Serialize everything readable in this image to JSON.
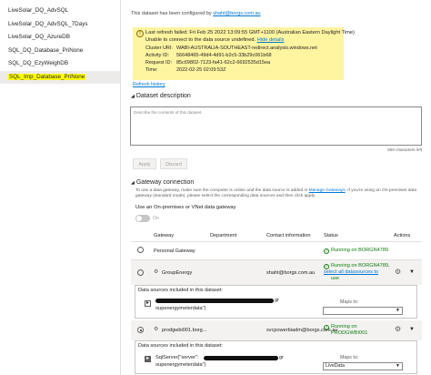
{
  "sidebar": {
    "items": [
      {
        "label": "LiveSolar_DQ_AdvSQL"
      },
      {
        "label": "LiveSolar_DQ_AdvSQL_7Days"
      },
      {
        "label": "LiveSolar_DQ_AzureDB"
      },
      {
        "label": "SQL_DQ_Database_PriNone"
      },
      {
        "label": "SQL_DQ_EzyWeighDB"
      },
      {
        "label": "SQL_Imp_Database_PriNone"
      }
    ],
    "selected_index": 5
  },
  "header": {
    "configured_prefix": "This dataset has been configured by",
    "configured_email": "shaht@borgs.com.au"
  },
  "alert": {
    "line1": "Last refresh failed: Fri Feb 25 2022 13:09:55 GMT+1100 (Australian Eastern Daylight Time)",
    "line2_text": "Unable to connect to the data source undefined.",
    "hide_details": "Hide details",
    "cluster_key": "Cluster URI:",
    "cluster_val": "WABI-AUSTRALIA-SOUTHEAST-redirect.analysis.windows.net",
    "activity_key": "Activity ID:",
    "activity_val": "56648465-49d4-4d91-b2c5-33b29c061b68",
    "request_key": "Request ID:",
    "request_val": "85c69802-7123-fa41-62c2-6692535d15ea",
    "time_key": "Time:",
    "time_val": "2022-02-25 02:09:53Z"
  },
  "refresh_history": "Refresh history",
  "dataset_description": {
    "title": "Dataset description",
    "placeholder": "Describe the contents of this dataset.",
    "char_count": "500 characters left",
    "apply": "Apply",
    "discard": "Discard"
  },
  "gateway": {
    "title": "Gateway connection",
    "help_prefix": "To use a data gateway, make sure the computer is online and the data source is added in",
    "help_link": "Manage Gateways",
    "help_suffix": ". If you're using an On-premises data",
    "help_line2": "gateway (standard mode), please select the corresponding data sources and then click apply.",
    "onprem_label": "Use an On-premises or VNet data gateway",
    "toggle_label": "On",
    "columns": {
      "gateway": "Gateway",
      "department": "Department",
      "contact": "Contact information",
      "status": "Status",
      "actions": "Actions"
    },
    "rows": [
      {
        "name": "Personal Gateway",
        "department": "",
        "contact": "",
        "status": "Running on BORGN4789"
      },
      {
        "name": "GroupEnergy",
        "department": "",
        "contact": "shaht@borgs.com.au",
        "status": "Running on BORGN4789,",
        "status_link": "select all datasources to",
        "status_tail": "use"
      },
      {
        "name": "prodgwbi001.borg...",
        "department": "",
        "contact": "svcpowerbiadm@borgs.com.au",
        "status": "Running on",
        "status2": "PRODGWBI001"
      }
    ],
    "panel1": {
      "title": "Data sources included in this dataset:",
      "source_tail": "gr",
      "source_line2": "oupenergymeterdata\")",
      "maps_to": "Maps to:",
      "select_value": ""
    },
    "panel2": {
      "title": "Data sources included in this dataset:",
      "source_prefix": "SqlServer{\"server\":",
      "source_tail": "gr",
      "source_line2": "oupenergymeterdata\")",
      "maps_to": "Maps to:",
      "select_value": "LiveData"
    }
  },
  "colors": {
    "alert_bg": "#fff4a0",
    "link": "#0078d4",
    "success": "#107c10",
    "highlight": "#ffff00"
  }
}
